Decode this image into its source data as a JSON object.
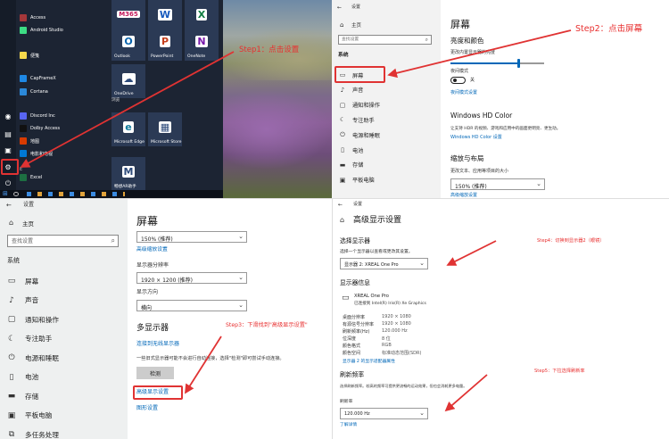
{
  "start_menu": {
    "apps": [
      {
        "label": "Access",
        "color": "#a4373a"
      },
      {
        "label": "Android Studio",
        "color": "#3ddc84"
      },
      {
        "label": "便笺",
        "color": "#f5d84c"
      },
      {
        "label": "CapFrameX",
        "color": "#1e88e5"
      },
      {
        "label": "Cortana",
        "color": "#2b88d8"
      },
      {
        "label": "Discord Inc",
        "color": "#5865f2"
      },
      {
        "label": "Dolby Access",
        "color": "#111111"
      },
      {
        "label": "地图",
        "color": "#d83b01"
      },
      {
        "label": "电影和电视",
        "color": "#0078d4"
      },
      {
        "label": "Excel",
        "color": "#1d6f42"
      }
    ],
    "section_e": "E",
    "tiles": [
      {
        "label": "",
        "glyph": "M365",
        "color": "#c2185b"
      },
      {
        "label": "Word",
        "glyph": "W",
        "color": "#185abd"
      },
      {
        "label": "Excel",
        "glyph": "X",
        "color": "#107c41"
      },
      {
        "label": "Outlook",
        "glyph": "O",
        "color": "#0a64ad"
      },
      {
        "label": "PowerPoint",
        "glyph": "P",
        "color": "#c43e1c"
      },
      {
        "label": "OneNote",
        "glyph": "N",
        "color": "#7719aa"
      },
      {
        "label": "OneDrive",
        "glyph": "☁",
        "color": "#2d4a7a"
      },
      {
        "label": "Microsoft Edge",
        "glyph": "e",
        "color": "#0f7a9c"
      },
      {
        "label": "Microsoft Store",
        "glyph": "▦",
        "color": "#2d4a7a"
      },
      {
        "label": "畅想AR助手",
        "glyph": "M",
        "color": "#2d4a7a"
      }
    ],
    "group_label": "浏览"
  },
  "step1": "Step1：点击设置",
  "step2": "Step2：点击屏幕",
  "step3": "Step3：下滑找到\"高级显示设置\"",
  "step4": "Step4：切换到显示器2（眼镜）",
  "step5": "Step5：下拉选择刷新率",
  "settings_small": {
    "window_title": "设置",
    "home": "主页",
    "search_placeholder": "查找设置",
    "system": "系统",
    "nav": [
      "屏幕",
      "声音",
      "通知和操作",
      "专注助手",
      "电源和睡眠",
      "电池",
      "存储",
      "平板电脑"
    ],
    "title": "屏幕",
    "brightness_title": "亮度和颜色",
    "brightness_label": "更改内置显示器的亮度",
    "brightness_value": 0.72,
    "night_label": "夜间模式",
    "night_state": "关",
    "night_link": "夜间模式设置",
    "hdr_title": "Windows HD Color",
    "hdr_desc": "让支持 HDR 的视频、游戏和应用中的画面更明亮、更生动。",
    "hdr_link": "Windows HD Color 设置",
    "scale_title": "缩放与布局",
    "scale_label": "更改文本、应用等项目的大小",
    "scale_value": "150% (推荐)",
    "scale_link": "高级缩放设置"
  },
  "settings_large": {
    "window_title": "设置",
    "home": "主页",
    "search_placeholder": "查找设置",
    "system": "系统",
    "nav": [
      "屏幕",
      "声音",
      "通知和操作",
      "专注助手",
      "电源和睡眠",
      "电池",
      "存储",
      "平板电脑",
      "多任务处理"
    ],
    "title": "屏幕",
    "scale_value": "150% (推荐)",
    "scale_link": "高级缩放设置",
    "resolution_label": "显示器分辨率",
    "resolution_value": "1920 × 1200 (推荐)",
    "orientation_label": "显示方向",
    "orientation_value": "横向",
    "multi_title": "多显示器",
    "wireless_link": "连接到无线显示器",
    "multi_desc": "一些旧式显示器可能不会进行自动连接，选择\"检测\"即可尝试手动连接。",
    "detect_button": "检测",
    "advanced_link": "高级显示设置",
    "graphics_link": "图形设置"
  },
  "advanced": {
    "window_title": "设置",
    "title": "高级显示设置",
    "select_title": "选择显示器",
    "select_label": "选择一个显示器以查看或更改其设置。",
    "select_value": "显示器 2: XREAL One Pro",
    "info_title": "显示器信息",
    "monitor_name": "XREAL One Pro",
    "monitor_sub": "已连接到 Intel(R) Iris(R) Xe Graphics",
    "info_rows": [
      {
        "k": "桌面分辨率",
        "v": "1920 × 1080"
      },
      {
        "k": "有源信号分辨率",
        "v": "1920 × 1080"
      },
      {
        "k": "刷新频率(Hz)",
        "v": "120.000 Hz"
      },
      {
        "k": "位深度",
        "v": "8 位"
      },
      {
        "k": "颜色格式",
        "v": "RGB"
      },
      {
        "k": "颜色空间",
        "v": "标准动态范围(SDR)"
      }
    ],
    "adapter_link": "显示器 2 的显示适配器属性",
    "refresh_title": "刷新频率",
    "refresh_desc": "选择刷新频率。较高的频率可提供更流畅的运动效果，但也会消耗更多电量。",
    "refresh_label": "刷新率",
    "refresh_value": "120.000 Hz",
    "more_link": "了解详情"
  }
}
